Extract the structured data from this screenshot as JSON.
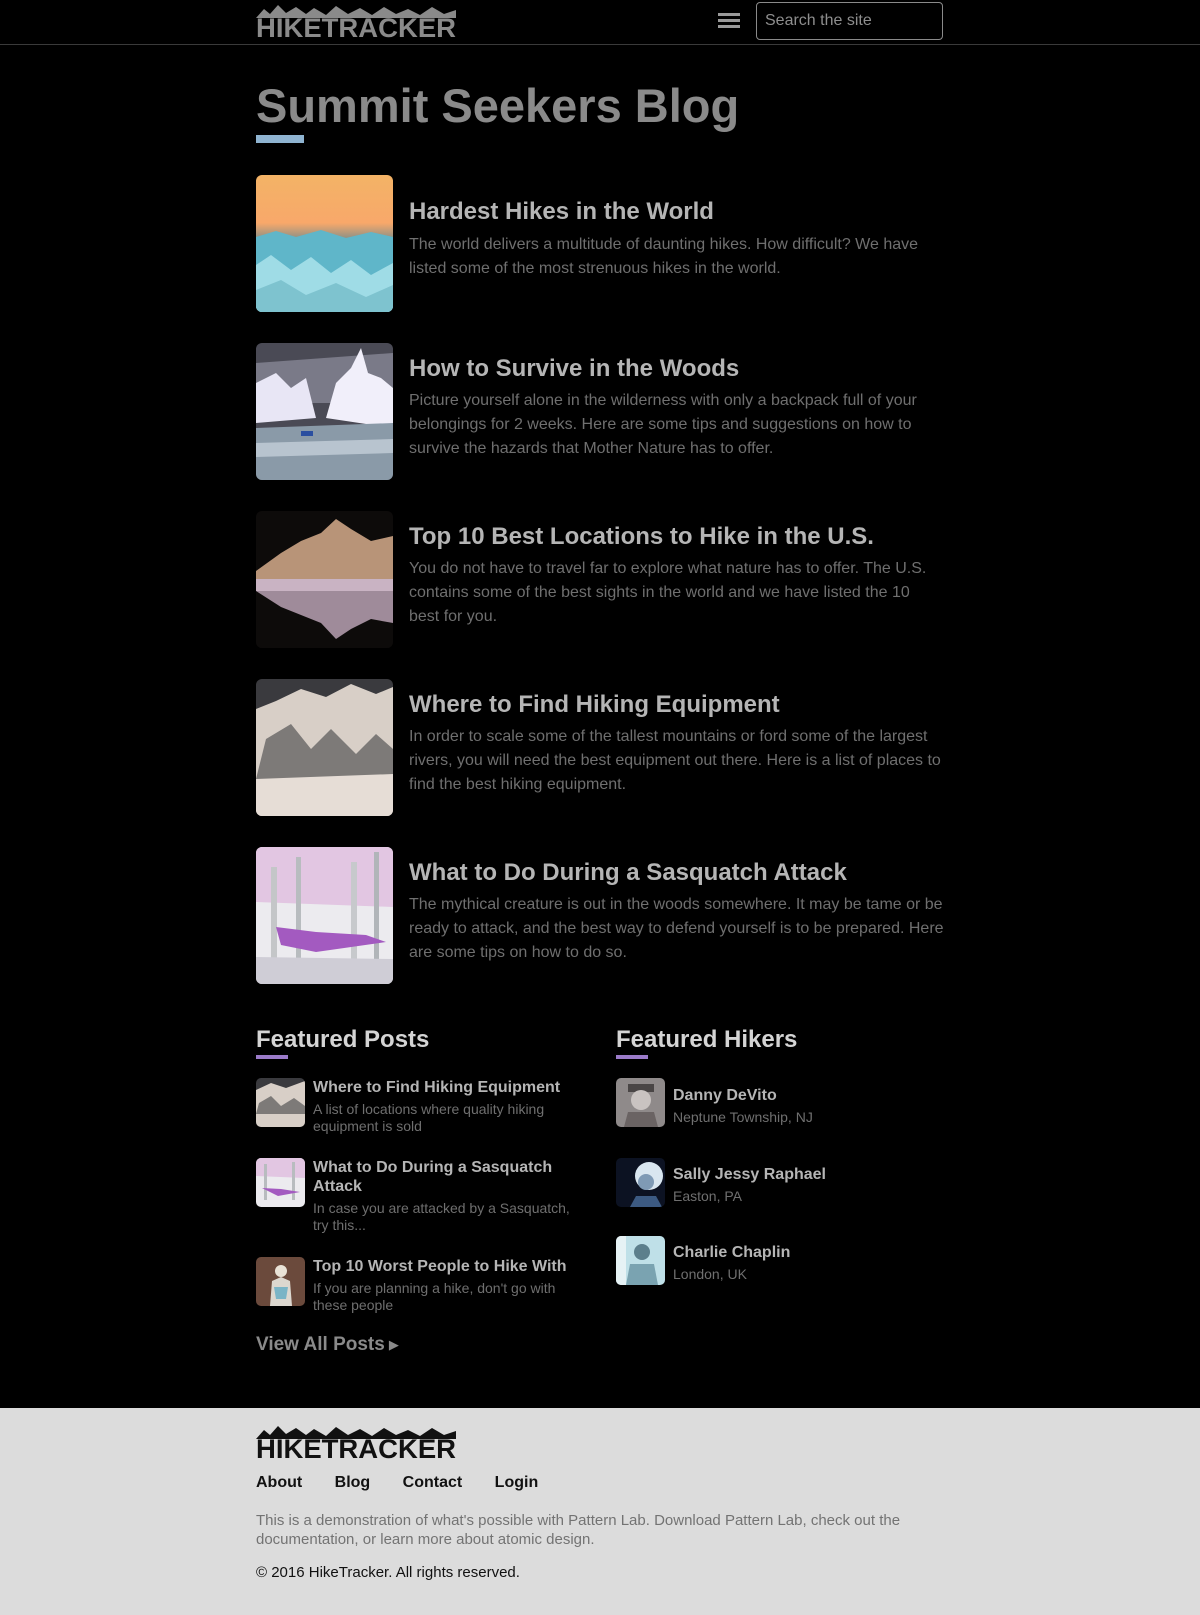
{
  "header": {
    "logo_text": "HIKETRACKER",
    "menu_icon": "hamburger-menu-icon",
    "search_placeholder": "Search the site"
  },
  "page_title": "Summit Seekers Blog",
  "accent_colors": {
    "title_underline": "#8fb4d1",
    "section_underline": "#9b7bc9"
  },
  "posts": [
    {
      "title": "Hardest Hikes in the World",
      "description": "The world delivers a multitude of daunting hikes. How difficult? We have listed some of the most strenuous hikes in the world."
    },
    {
      "title": "How to Survive in the Woods",
      "description": "Picture yourself alone in the wilderness with only a backpack full of your belongings for 2 weeks. Here are some tips and suggestions on how to survive the hazards that Mother Nature has to offer."
    },
    {
      "title": "Top 10 Best Locations to Hike in the U.S.",
      "description": "You do not have to travel far to explore what nature has to offer. The U.S. contains some of the best sights in the world and we have listed the 10 best for you."
    },
    {
      "title": "Where to Find Hiking Equipment",
      "description": "In order to scale some of the tallest mountains or ford some of the largest rivers, you will need the best equipment out there. Here is a list of places to find the best hiking equipment."
    },
    {
      "title": "What to Do During a Sasquatch Attack",
      "description": "The mythical creature is out in the woods somewhere. It may be tame or be ready to attack, and the best way to defend yourself is to be prepared. Here are some tips on how to do so."
    }
  ],
  "featured_posts": {
    "heading": "Featured Posts",
    "items": [
      {
        "title": "Where to Find Hiking Equipment",
        "description": "A list of locations where quality hiking equipment is sold"
      },
      {
        "title": "What to Do During a Sasquatch Attack",
        "description": "In case you are attacked by a Sasquatch, try this..."
      },
      {
        "title": "Top 10 Worst People to Hike With",
        "description": "If you are planning a hike, don't go with these people"
      }
    ],
    "view_all": "View All Posts",
    "view_all_icon": "right-triangle-arrow-icon"
  },
  "featured_hikers": {
    "heading": "Featured Hikers",
    "items": [
      {
        "name": "Danny DeVito",
        "location": "Neptune Township, NJ"
      },
      {
        "name": "Sally Jessy Raphael",
        "location": "Easton, PA"
      },
      {
        "name": "Charlie Chaplin",
        "location": "London, UK"
      }
    ]
  },
  "footer": {
    "logo_text": "HIKETRACKER",
    "nav": [
      "About",
      "Blog",
      "Contact",
      "Login"
    ],
    "text": "This is a demonstration of what's possible with Pattern Lab. Download Pattern Lab, check out the documentation, or learn more about atomic design.",
    "copyright": "© 2016 HikeTracker. All rights reserved."
  }
}
